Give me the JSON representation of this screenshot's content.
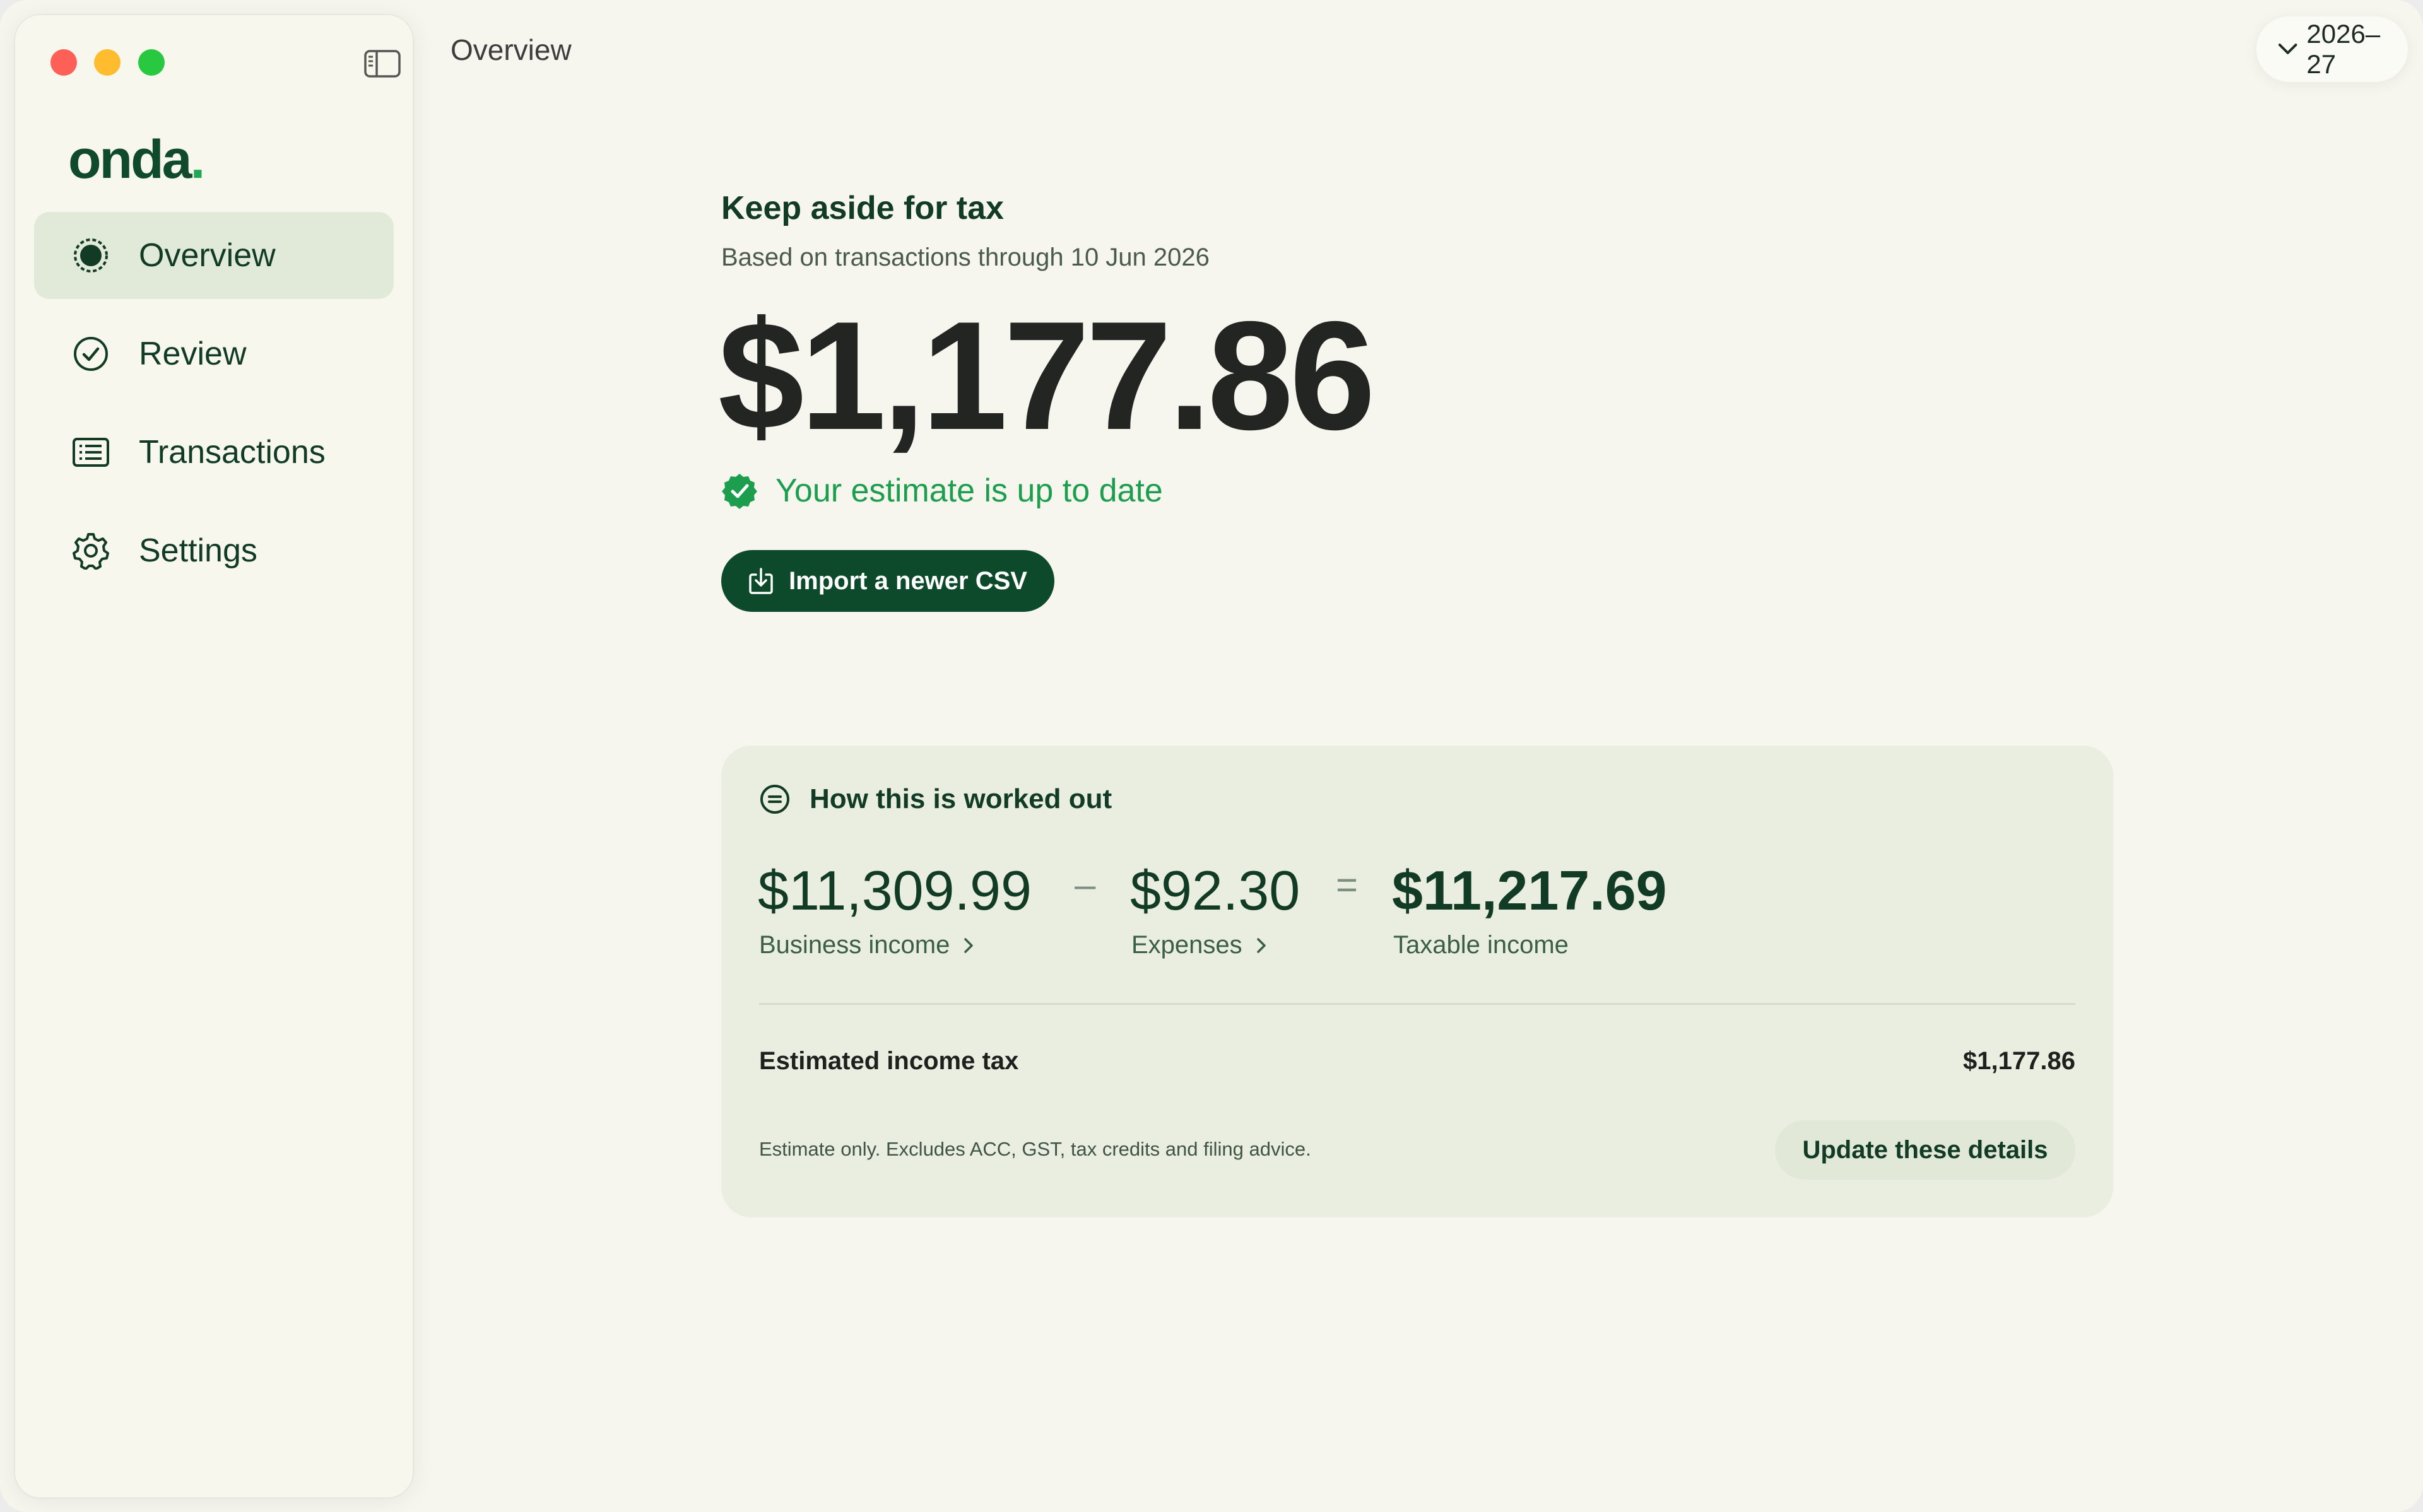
{
  "window": {
    "title": "Overview",
    "controls": [
      "close",
      "minimize",
      "zoom"
    ]
  },
  "sidebar": {
    "toggle_icon": "sidebar-toggle-icon",
    "logo": {
      "text": "onda",
      "dot": "."
    },
    "items": [
      {
        "label": "Overview",
        "icon": "overview-icon",
        "active": true
      },
      {
        "label": "Review",
        "icon": "check-circle-icon",
        "active": false
      },
      {
        "label": "Transactions",
        "icon": "list-icon",
        "active": false
      },
      {
        "label": "Settings",
        "icon": "gear-icon",
        "active": false
      }
    ]
  },
  "header": {
    "title": "Overview",
    "year_selector": {
      "value": "2026–27",
      "icon": "chevron-down-icon"
    }
  },
  "summary": {
    "title": "Keep aside for tax",
    "subtitle": "Based on transactions through 10 Jun 2026",
    "amount": "$1,177.86",
    "status": "Your estimate is up to date",
    "import_button": "Import a newer CSV"
  },
  "breakdown": {
    "title": "How this is worked out",
    "business_income": {
      "amount": "$11,309.99",
      "label": "Business income"
    },
    "minus": "–",
    "expenses": {
      "amount": "$92.30",
      "label": "Expenses"
    },
    "equals": "=",
    "taxable_income": {
      "amount": "$11,217.69",
      "label": "Taxable income"
    },
    "tax_row": {
      "label": "Estimated income tax",
      "value": "$1,177.86"
    },
    "disclaimer": "Estimate only. Excludes ACC, GST, tax credits and filing advice.",
    "update_button": "Update these details"
  },
  "colors": {
    "accent": "#0d4a2b",
    "success": "#1c9e4e",
    "background": "#f6f5ee",
    "card": "#eaeee1"
  }
}
